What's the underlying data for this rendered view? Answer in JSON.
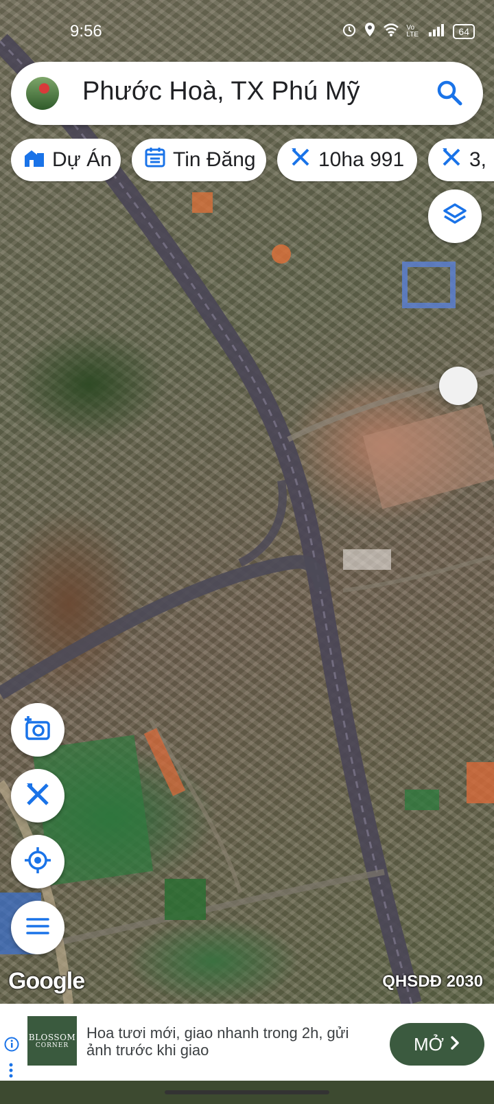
{
  "status_bar": {
    "time": "9:56",
    "network": "Vo LTE",
    "battery": "64"
  },
  "search": {
    "location": "Phước Hoà, TX Phú Mỹ"
  },
  "chips": [
    {
      "label": "Dự Án",
      "icon": "building-icon"
    },
    {
      "label": "Tin Đăng",
      "icon": "calendar-list-icon"
    },
    {
      "label": "10ha 991",
      "icon": "ruler-pencil-icon"
    },
    {
      "label": "3,",
      "icon": "ruler-pencil-icon"
    }
  ],
  "map": {
    "logo": "Google",
    "attribution": "QHSDĐ 2030"
  },
  "fab_icons": [
    "add-photo-icon",
    "ruler-pencil-icon",
    "my-location-icon",
    "menu-icon"
  ],
  "layers_icon": "layers-icon",
  "ad": {
    "logo_line1": "BLOSSOM",
    "logo_line2": "CORNER",
    "text": "Hoa tươi mới, giao nhanh trong 2h, gửi ảnh trước khi giao",
    "button": "MỞ"
  },
  "colors": {
    "accent_blue": "#1a73e8",
    "ad_button": "#3b5a3f"
  }
}
